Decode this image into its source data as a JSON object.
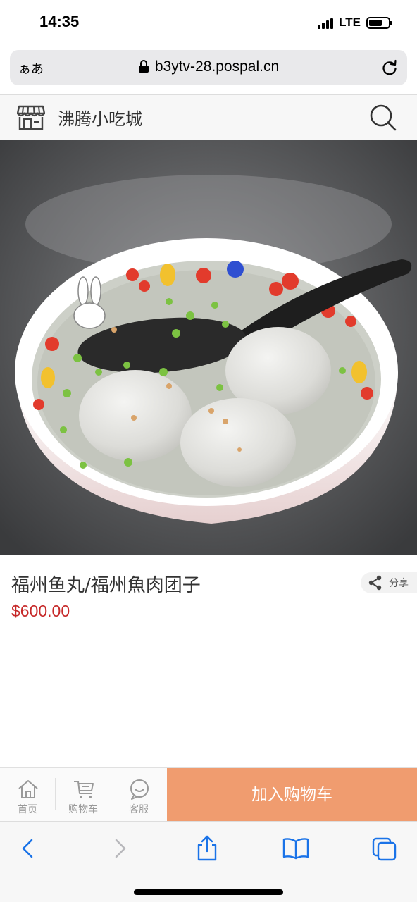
{
  "status_bar": {
    "time": "14:35",
    "network": "LTE"
  },
  "browser": {
    "text_size_label": "ぁあ",
    "url": "b3ytv-28.pospal.cn"
  },
  "shop": {
    "name": "沸腾小吃城"
  },
  "product": {
    "title": "福州鱼丸/福州魚肉团子",
    "price": "$600.00",
    "share_label": "分享"
  },
  "bottom_nav": {
    "items": [
      {
        "label": "首页",
        "icon": "home-icon"
      },
      {
        "label": "购物车",
        "icon": "cart-icon"
      },
      {
        "label": "客服",
        "icon": "chat-icon"
      }
    ],
    "add_to_cart_label": "加入购物车",
    "accent": "#f09c6f"
  },
  "colors": {
    "price": "#c62828",
    "link_blue": "#1a73e8"
  }
}
